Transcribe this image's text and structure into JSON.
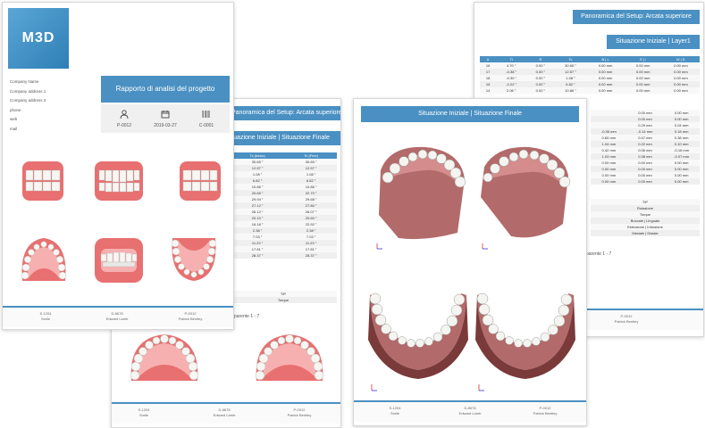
{
  "cover": {
    "logo": "M3D",
    "company_lines": [
      "Company Name",
      "Company address 1",
      "Company address 2",
      "phone",
      "web",
      "mail"
    ],
    "title": "Rapporto di analisi del progetto",
    "meta": [
      {
        "icon": "user-icon",
        "value": "P-0012"
      },
      {
        "icon": "calendar-icon",
        "value": "2019-03-27"
      },
      {
        "icon": "barcode-icon",
        "value": "C-0001"
      }
    ]
  },
  "page2": {
    "header": "Panoramica del Setup: Arcata superiore",
    "subheader": "Situazione Iniziale | Situazione Finale",
    "columns": [
      "Tc (Inizio)",
      "Tc (Fine)"
    ],
    "rows": [
      [
        "30.65 °",
        "30.65 °"
      ],
      [
        "12.57 °",
        "12.57 °"
      ],
      [
        "1.08 °",
        "1.08 °"
      ],
      [
        "6.82 °",
        "6.82 °"
      ],
      [
        "10.86 °",
        "10.86 °"
      ],
      [
        "20.65 °",
        "22.70 °"
      ],
      [
        "29.94 °",
        "29.68 °"
      ],
      [
        "27.12 °",
        "27.80 °"
      ],
      [
        "26.12 °",
        "26.07 °"
      ],
      [
        "20.10 °",
        "20.60 °"
      ],
      [
        "16.18 °",
        "22.92 °"
      ],
      [
        "2.38 °",
        "2.38 °"
      ],
      [
        "7.03 °",
        "7.03 °"
      ],
      [
        "11.23 °",
        "11.23 °"
      ],
      [
        "17.81 °",
        "17.81 °"
      ],
      [
        "28.37 °",
        "28.37 °"
      ]
    ],
    "tip_label": "TIP",
    "torque_label": "Torque",
    "transparency": "rasparente 1 - 7"
  },
  "page3": {
    "header": "Situazione Iniziale | Situazione Finale"
  },
  "page4": {
    "header": "Panoramica del Setup: Arcata superiore",
    "subheader": "Situazione Iniziale | Layer1",
    "columns": [
      "#",
      "Ti",
      "R",
      "Tc",
      "B | L",
      "E | I",
      "M | D"
    ],
    "rows": [
      [
        "16",
        "4.70 °",
        "0.00 °",
        "30.65 °",
        "0.00 mm",
        "0.00 mm",
        "0.00 mm"
      ],
      [
        "17",
        "-0.38 °",
        "0.00 °",
        "12.57 °",
        "0.00 mm",
        "0.00 mm",
        "0.00 mm"
      ],
      [
        "18",
        "-0.30 °",
        "0.00 °",
        "1.08 °",
        "0.00 mm",
        "0.00 mm",
        "0.00 mm"
      ],
      [
        "15",
        "-2.22 °",
        "0.00 °",
        "6.82 °",
        "0.00 mm",
        "0.00 mm",
        "0.00 mm"
      ],
      [
        "14",
        "2.06 °",
        "0.00 °",
        "10.86 °",
        "0.00 mm",
        "0.00 mm",
        "0.00 mm"
      ]
    ],
    "partial_rows": [
      [
        "",
        "0.00 mm",
        "0.00 mm"
      ],
      [
        "",
        "0.00 mm",
        "0.00 mm"
      ],
      [
        "",
        "0.29 mm",
        "0.04 mm"
      ],
      [
        "-0.36 mm",
        "-0.14 mm",
        "0.18 mm"
      ],
      [
        "0.60 mm",
        "0.47 mm",
        "0.38 mm"
      ],
      [
        "1.04 mm",
        "0.22 mm",
        "0.10 mm"
      ],
      [
        "0.42 mm",
        "0.06 mm",
        "-0.16 mm"
      ],
      [
        "1.03 mm",
        "0.38 mm",
        "-0.07 mm"
      ],
      [
        "0.00 mm",
        "0.00 mm",
        "0.00 mm"
      ],
      [
        "0.00 mm",
        "0.00 mm",
        "0.00 mm"
      ],
      [
        "0.00 mm",
        "0.00 mm",
        "0.00 mm"
      ],
      [
        "0.00 mm",
        "0.00 mm",
        "0.00 mm"
      ]
    ],
    "legend_rows": [
      "TIP",
      "Rotazione",
      "Torque",
      "Buccale | Linguale",
      "Estrusione | Intrusione",
      "Mesiale | Distale"
    ],
    "transparency": "rasparente 1 - 7"
  },
  "footer": {
    "cols": [
      [
        "S-1204",
        "Smile"
      ],
      [
        "D-8678",
        "Edward Lamb"
      ],
      [
        "P-0012",
        "Patrick Bentley"
      ]
    ]
  },
  "colors": {
    "accent": "#4a90c2",
    "gum": "#e87070",
    "tooth": "#f4f4f0",
    "arch3d": "#b36a6a"
  }
}
